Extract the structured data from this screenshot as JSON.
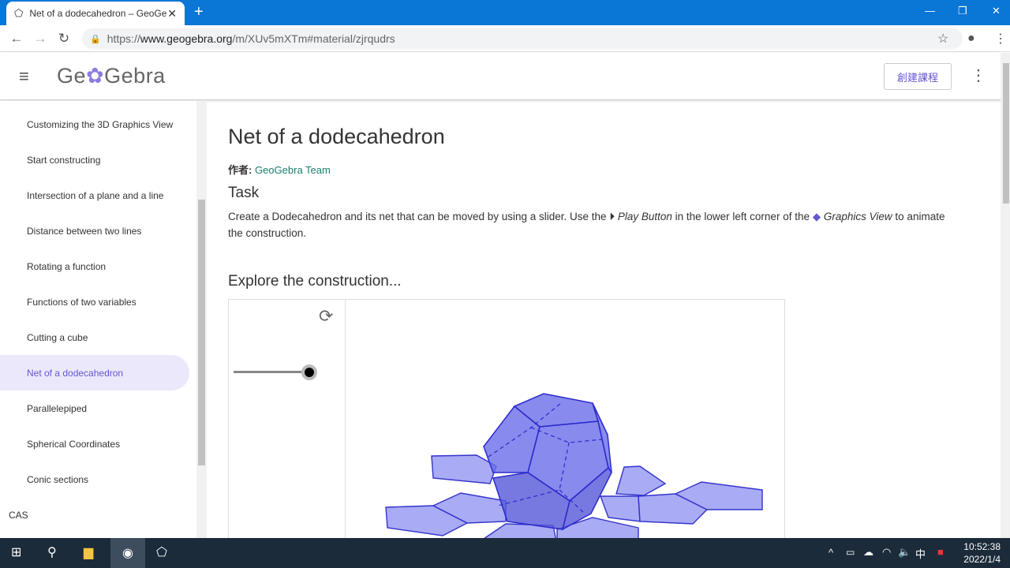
{
  "browser": {
    "tab_title": "Net of a dodecahedron – GeoGebra",
    "url_prefix": "https://",
    "url_domain": "www.geogebra.org",
    "url_path": "/m/XUv5mXTm#material/zjrqudrs"
  },
  "header": {
    "logo": "GeoGebra",
    "create_button": "創建課程"
  },
  "sidebar": {
    "items": [
      {
        "label": "Customizing the 3D Graphics View"
      },
      {
        "label": "Start constructing"
      },
      {
        "label": "Intersection of a plane and a line"
      },
      {
        "label": "Distance between two lines"
      },
      {
        "label": "Rotating a function"
      },
      {
        "label": "Functions of two variables"
      },
      {
        "label": "Cutting a cube"
      },
      {
        "label": "Net of a dodecahedron",
        "active": true
      },
      {
        "label": "Parallelepiped"
      },
      {
        "label": "Spherical Coordinates"
      },
      {
        "label": "Conic sections"
      }
    ],
    "category": "CAS"
  },
  "main": {
    "title": "Net of a dodecahedron",
    "author_label": "作者:",
    "author": "GeoGebra Team",
    "task_heading": "Task",
    "task_1": "Create a Dodecahedron and its net that can be moved by using a slider. Use the ",
    "play_button": "Play Button",
    "task_2": " in the lower left corner of the ",
    "graphics_view": "Graphics View",
    "task_3": " to animate the construction.",
    "explore_heading": "Explore the construction...",
    "slider_value": 1.0
  },
  "taskbar": {
    "time": "10:52:38",
    "date": "2022/1/4",
    "ime": "中"
  },
  "colors": {
    "accent": "#6557d2",
    "solid": "#5b5be0"
  }
}
